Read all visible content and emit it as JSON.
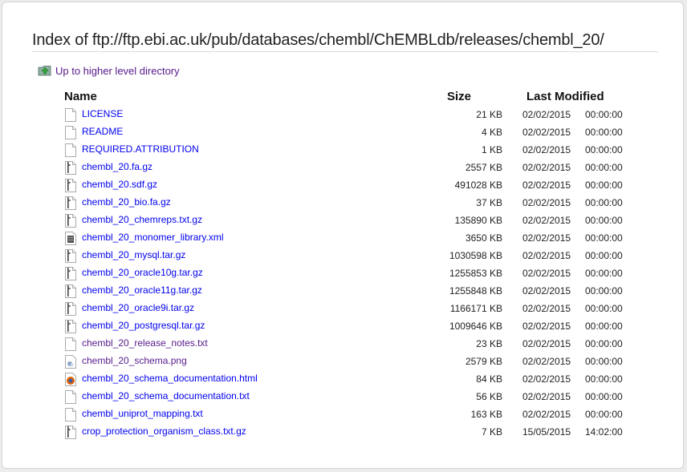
{
  "page": {
    "title": "Index of ftp://ftp.ebi.ac.uk/pub/databases/chembl/ChEMBLdb/releases/chembl_20/",
    "up_link": "Up to higher level directory"
  },
  "columns": {
    "name": "Name",
    "size": "Size",
    "modified": "Last Modified"
  },
  "files": [
    {
      "name": "LICENSE",
      "size": "21 KB",
      "date": "02/02/2015",
      "time": "00:00:00",
      "icon": "text-file-icon",
      "visited": false
    },
    {
      "name": "README",
      "size": "4 KB",
      "date": "02/02/2015",
      "time": "00:00:00",
      "icon": "text-file-icon",
      "visited": false
    },
    {
      "name": "REQUIRED.ATTRIBUTION",
      "size": "1 KB",
      "date": "02/02/2015",
      "time": "00:00:00",
      "icon": "text-file-icon",
      "visited": false
    },
    {
      "name": "chembl_20.fa.gz",
      "size": "2557 KB",
      "date": "02/02/2015",
      "time": "00:00:00",
      "icon": "archive-file-icon",
      "visited": false
    },
    {
      "name": "chembl_20.sdf.gz",
      "size": "491028 KB",
      "date": "02/02/2015",
      "time": "00:00:00",
      "icon": "archive-file-icon",
      "visited": false
    },
    {
      "name": "chembl_20_bio.fa.gz",
      "size": "37 KB",
      "date": "02/02/2015",
      "time": "00:00:00",
      "icon": "archive-file-icon",
      "visited": false
    },
    {
      "name": "chembl_20_chemreps.txt.gz",
      "size": "135890 KB",
      "date": "02/02/2015",
      "time": "00:00:00",
      "icon": "archive-file-icon",
      "visited": false
    },
    {
      "name": "chembl_20_monomer_library.xml",
      "size": "3650 KB",
      "date": "02/02/2015",
      "time": "00:00:00",
      "icon": "xml-file-icon",
      "visited": false
    },
    {
      "name": "chembl_20_mysql.tar.gz",
      "size": "1030598 KB",
      "date": "02/02/2015",
      "time": "00:00:00",
      "icon": "archive-file-icon",
      "visited": false
    },
    {
      "name": "chembl_20_oracle10g.tar.gz",
      "size": "1255853 KB",
      "date": "02/02/2015",
      "time": "00:00:00",
      "icon": "archive-file-icon",
      "visited": false
    },
    {
      "name": "chembl_20_oracle11g.tar.gz",
      "size": "1255848 KB",
      "date": "02/02/2015",
      "time": "00:00:00",
      "icon": "archive-file-icon",
      "visited": false
    },
    {
      "name": "chembl_20_oracle9i.tar.gz",
      "size": "1166171 KB",
      "date": "02/02/2015",
      "time": "00:00:00",
      "icon": "archive-file-icon",
      "visited": false
    },
    {
      "name": "chembl_20_postgresql.tar.gz",
      "size": "1009646 KB",
      "date": "02/02/2015",
      "time": "00:00:00",
      "icon": "archive-file-icon",
      "visited": false
    },
    {
      "name": "chembl_20_release_notes.txt",
      "size": "23 KB",
      "date": "02/02/2015",
      "time": "00:00:00",
      "icon": "text-file-icon",
      "visited": true
    },
    {
      "name": "chembl_20_schema.png",
      "size": "2579 KB",
      "date": "02/02/2015",
      "time": "00:00:00",
      "icon": "image-file-icon",
      "visited": true
    },
    {
      "name": "chembl_20_schema_documentation.html",
      "size": "84 KB",
      "date": "02/02/2015",
      "time": "00:00:00",
      "icon": "html-file-icon",
      "visited": false
    },
    {
      "name": "chembl_20_schema_documentation.txt",
      "size": "56 KB",
      "date": "02/02/2015",
      "time": "00:00:00",
      "icon": "text-file-icon",
      "visited": false
    },
    {
      "name": "chembl_uniprot_mapping.txt",
      "size": "163 KB",
      "date": "02/02/2015",
      "time": "00:00:00",
      "icon": "text-file-icon",
      "visited": false
    },
    {
      "name": "crop_protection_organism_class.txt.gz",
      "size": "7 KB",
      "date": "15/05/2015",
      "time": "14:02:00",
      "icon": "archive-file-icon",
      "visited": false
    }
  ],
  "colors": {
    "link": "#0000ee",
    "visited": "#551a8b"
  }
}
